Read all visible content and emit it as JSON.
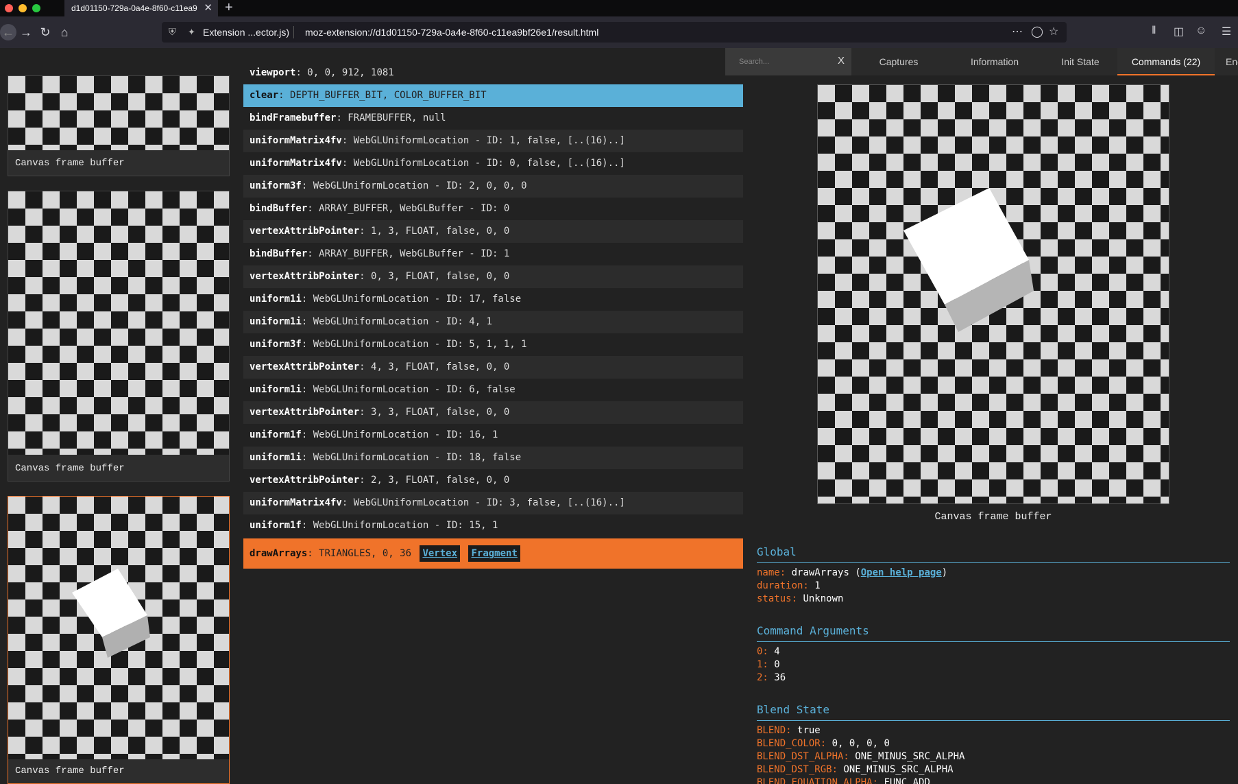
{
  "browser": {
    "tab_title": "d1d01150-729a-0a4e-8f60-c11ea9",
    "tab_close": "✕",
    "new_tab": "+",
    "extension_label": "Extension ...ector.js)",
    "url": "moz-extension://d1d01150-729a-0a4e-8f60-c11ea9bf26e1/result.html"
  },
  "topbar": {
    "search_placeholder": "Search...",
    "search_clear": "X",
    "tabs": [
      {
        "label": "Captures"
      },
      {
        "label": "Information"
      },
      {
        "label": "Init State"
      },
      {
        "label": "Commands (22)"
      },
      {
        "label": "End State"
      }
    ],
    "active_tab": "Commands (22)",
    "accent_color": "#f0732a"
  },
  "thumbnails": [
    {
      "label": "Canvas frame buffer"
    },
    {
      "label": "Canvas frame buffer"
    },
    {
      "label": "Canvas frame buffer"
    }
  ],
  "commands": [
    {
      "name": "viewport",
      "args": ": 0, 0, 912, 1081"
    },
    {
      "name": "clear",
      "args": ": DEPTH_BUFFER_BIT, COLOR_BUFFER_BIT"
    },
    {
      "name": "bindFramebuffer",
      "args": ": FRAMEBUFFER, null"
    },
    {
      "name": "uniformMatrix4fv",
      "args": ": WebGLUniformLocation - ID: 1, false, [..(16)..]"
    },
    {
      "name": "uniformMatrix4fv",
      "args": ": WebGLUniformLocation - ID: 0, false, [..(16)..]"
    },
    {
      "name": "uniform3f",
      "args": ": WebGLUniformLocation - ID: 2, 0, 0, 0"
    },
    {
      "name": "bindBuffer",
      "args": ": ARRAY_BUFFER, WebGLBuffer - ID: 0"
    },
    {
      "name": "vertexAttribPointer",
      "args": ": 1, 3, FLOAT, false, 0, 0"
    },
    {
      "name": "bindBuffer",
      "args": ": ARRAY_BUFFER, WebGLBuffer - ID: 1"
    },
    {
      "name": "vertexAttribPointer",
      "args": ": 0, 3, FLOAT, false, 0, 0"
    },
    {
      "name": "uniform1i",
      "args": ": WebGLUniformLocation - ID: 17, false"
    },
    {
      "name": "uniform1i",
      "args": ": WebGLUniformLocation - ID: 4, 1"
    },
    {
      "name": "uniform3f",
      "args": ": WebGLUniformLocation - ID: 5, 1, 1, 1"
    },
    {
      "name": "vertexAttribPointer",
      "args": ": 4, 3, FLOAT, false, 0, 0"
    },
    {
      "name": "uniform1i",
      "args": ": WebGLUniformLocation - ID: 6, false"
    },
    {
      "name": "vertexAttribPointer",
      "args": ": 3, 3, FLOAT, false, 0, 0"
    },
    {
      "name": "uniform1f",
      "args": ": WebGLUniformLocation - ID: 16, 1"
    },
    {
      "name": "uniform1i",
      "args": ": WebGLUniformLocation - ID: 18, false"
    },
    {
      "name": "vertexAttribPointer",
      "args": ": 2, 3, FLOAT, false, 0, 0"
    },
    {
      "name": "uniformMatrix4fv",
      "args": ": WebGLUniformLocation - ID: 3, false, [..(16)..]"
    },
    {
      "name": "uniform1f",
      "args": ": WebGLUniformLocation - ID: 15, 1"
    }
  ],
  "draw_command": {
    "name": "drawArrays",
    "args": ": TRIANGLES, 0, 36",
    "vertex_link": "Vertex",
    "fragment_link": "Fragment"
  },
  "preview": {
    "label": "Canvas frame buffer"
  },
  "global": {
    "title": "Global",
    "name_key": "name:",
    "name_value": "drawArrays",
    "help_link": "Open help page",
    "duration_key": "duration:",
    "duration_value": "1",
    "status_key": "status:",
    "status_value": "Unknown"
  },
  "command_arguments": {
    "title": "Command Arguments",
    "items": [
      {
        "key": "0:",
        "value": "4"
      },
      {
        "key": "1:",
        "value": "0"
      },
      {
        "key": "2:",
        "value": "36"
      }
    ]
  },
  "blend_state": {
    "title": "Blend State",
    "items": [
      {
        "key": "BLEND:",
        "value": "true"
      },
      {
        "key": "BLEND_COLOR:",
        "value": "0, 0, 0, 0"
      },
      {
        "key": "BLEND_DST_ALPHA:",
        "value": "ONE_MINUS_SRC_ALPHA"
      },
      {
        "key": "BLEND_DST_RGB:",
        "value": "ONE_MINUS_SRC_ALPHA"
      },
      {
        "key": "BLEND_EQUATION_ALPHA:",
        "value": "FUNC_ADD"
      }
    ]
  }
}
